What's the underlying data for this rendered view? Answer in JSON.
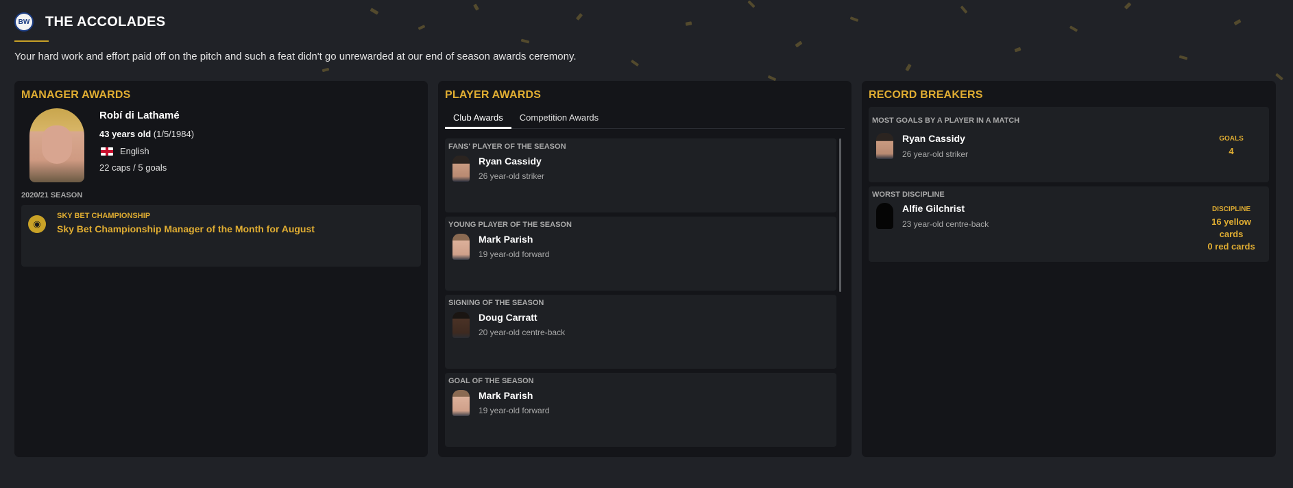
{
  "header": {
    "title": "THE ACCOLADES",
    "intro": "Your hard work and effort paid off on the pitch and such a feat didn't go unrewarded at our end of season awards ceremony."
  },
  "manager_awards": {
    "title": "MANAGER AWARDS",
    "name": "Robí di Lathamé",
    "age_bold": "43 years old",
    "dob": "(1/5/1984)",
    "nationality": "English",
    "caps": "22 caps / 5 goals",
    "season_label": "2020/21 SEASON",
    "award": {
      "competition": "SKY BET CHAMPIONSHIP",
      "name": "Sky Bet Championship Manager of the Month for August"
    }
  },
  "player_awards": {
    "title": "PLAYER AWARDS",
    "tabs": [
      "Club Awards",
      "Competition Awards"
    ],
    "active_tab": "Club Awards",
    "awards": [
      {
        "title": "FANS' PLAYER OF THE SEASON",
        "player": "Ryan Cassidy",
        "desc": "26 year-old striker"
      },
      {
        "title": "YOUNG PLAYER OF THE SEASON",
        "player": "Mark Parish",
        "desc": "19 year-old forward"
      },
      {
        "title": "SIGNING OF THE SEASON",
        "player": "Doug Carratt",
        "desc": "20 year-old centre-back"
      },
      {
        "title": "GOAL OF THE SEASON",
        "player": "Mark Parish",
        "desc": "19 year-old forward"
      }
    ]
  },
  "record_breakers": {
    "title": "RECORD BREAKERS",
    "records": [
      {
        "title": "MOST GOALS BY A PLAYER IN A MATCH",
        "player": "Ryan Cassidy",
        "desc": "26 year-old striker",
        "stat_label": "GOALS",
        "stat_value": "4"
      },
      {
        "title": "WORST DISCIPLINE",
        "player": "Alfie Gilchrist",
        "desc": "23 year-old centre-back",
        "stat_label": "DISCIPLINE",
        "stat_value": "16 yellow cards",
        "stat_value2": "0 red cards"
      }
    ]
  },
  "colors": {
    "accent": "#e0ad32",
    "panel": "#141519",
    "card": "#1e2024",
    "background": "#202227"
  }
}
